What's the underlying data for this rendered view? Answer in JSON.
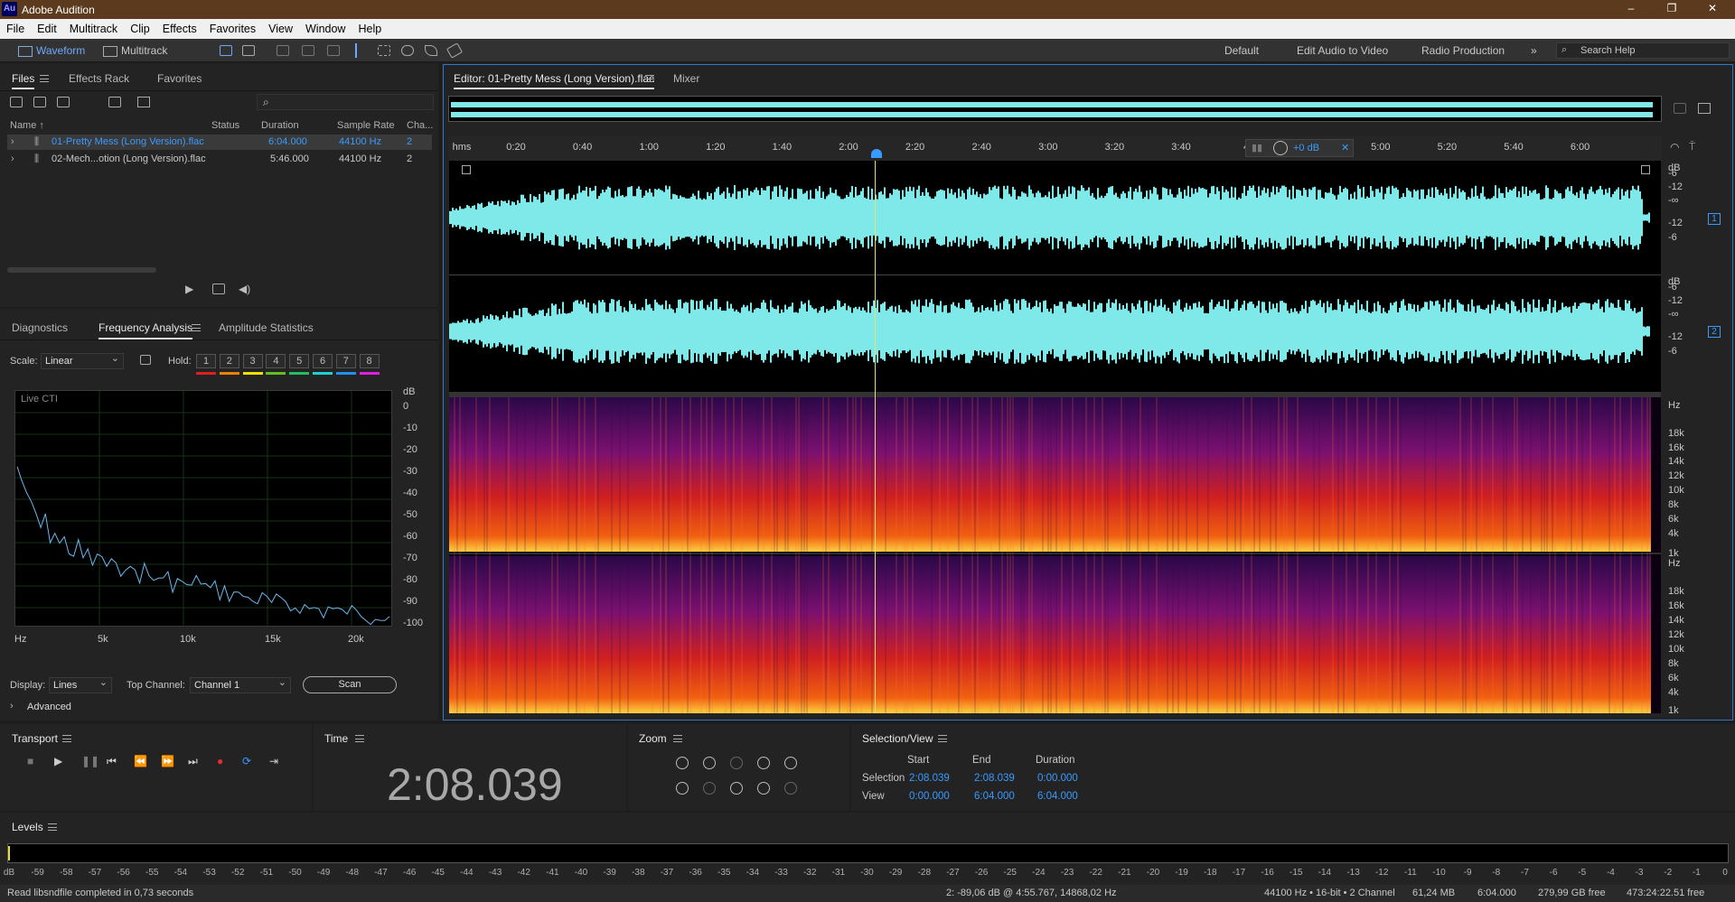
{
  "app": {
    "title": "Adobe Audition",
    "logo": "Au"
  },
  "menu": [
    "File",
    "Edit",
    "Multitrack",
    "Clip",
    "Effects",
    "Favorites",
    "View",
    "Window",
    "Help"
  ],
  "toolbar": {
    "waveform": "Waveform",
    "multitrack": "Multitrack",
    "workspaces": [
      "Default",
      "Edit Audio to Video",
      "Radio Production"
    ],
    "search_placeholder": "Search Help"
  },
  "files_panel": {
    "tabs": [
      "Files",
      "Effects Rack",
      "Favorites"
    ],
    "columns": [
      "Name ↑",
      "Status",
      "Duration",
      "Sample Rate",
      "Cha..."
    ],
    "rows": [
      {
        "name": "01-Pretty Mess (Long Version).flac",
        "duration": "6:04.000",
        "rate": "44100 Hz",
        "ch": "2",
        "selected": true
      },
      {
        "name": "02-Mech...otion (Long Version).flac",
        "duration": "5:46.000",
        "rate": "44100 Hz",
        "ch": "2",
        "selected": false
      }
    ]
  },
  "analysis_panel": {
    "tabs": [
      "Diagnostics",
      "Frequency Analysis",
      "Amplitude Statistics"
    ],
    "scale_label": "Scale:",
    "scale_value": "Linear",
    "hold_label": "Hold:",
    "hold": [
      "1",
      "2",
      "3",
      "4",
      "5",
      "6",
      "7",
      "8"
    ],
    "hold_colors": [
      "#e02020",
      "#f08000",
      "#f0e000",
      "#60c020",
      "#20c060",
      "#20d0d0",
      "#2090f0",
      "#e020e0"
    ],
    "graph_label": "Live CTI",
    "db_label": "dB",
    "db_ticks": [
      "0",
      "-10",
      "-20",
      "-30",
      "-40",
      "-50",
      "-60",
      "-70",
      "-80",
      "-90",
      "-100"
    ],
    "x_ticks": [
      "Hz",
      "5k",
      "10k",
      "15k",
      "20k"
    ],
    "display_label": "Display:",
    "display_value": "Lines",
    "top_channel_label": "Top Channel:",
    "top_channel_value": "Channel 1",
    "scan": "Scan",
    "advanced": "Advanced",
    "spectrum": [
      30,
      36,
      45,
      48,
      52,
      58,
      55,
      62,
      60,
      66,
      64,
      68,
      70,
      67,
      72,
      70,
      74,
      73,
      71,
      76,
      75,
      78,
      77,
      74,
      79,
      78,
      80,
      77,
      81,
      82,
      80,
      83,
      81,
      84,
      82,
      85,
      84,
      86,
      83,
      82,
      85,
      87,
      86,
      88,
      87,
      89,
      88,
      90,
      89,
      91,
      90,
      92,
      91,
      92,
      93,
      92,
      94,
      93,
      95,
      94,
      94,
      95,
      96,
      95,
      96,
      97,
      95,
      96,
      97,
      98,
      96,
      97,
      98,
      97,
      98,
      99,
      97,
      98,
      99,
      98
    ]
  },
  "editor": {
    "tab": "Editor: 01-Pretty Mess (Long Version).flac",
    "mixer": "Mixer",
    "hms": "hms",
    "ruler": [
      "0:20",
      "0:40",
      "1:00",
      "1:20",
      "1:40",
      "2:00",
      "2:20",
      "2:40",
      "3:00",
      "3:20",
      "3:40",
      "4:",
      "4:40",
      "5:00",
      "5:20",
      "5:40",
      "6:00"
    ],
    "vol": "+0 dB",
    "wave_db": [
      "dB",
      "-6",
      "-12",
      "-∞",
      "-12",
      "-6"
    ],
    "spec_hz": [
      "Hz",
      "18k",
      "16k",
      "14k",
      "12k",
      "10k",
      "8k",
      "6k",
      "4k",
      "1k"
    ],
    "channels": [
      "1",
      "2"
    ]
  },
  "transport": {
    "title": "Transport"
  },
  "time": {
    "title": "Time",
    "value": "2:08.039"
  },
  "zoom": {
    "title": "Zoom"
  },
  "selection": {
    "title": "Selection/View",
    "cols": [
      "Start",
      "End",
      "Duration"
    ],
    "rows": [
      {
        "label": "Selection",
        "start": "2:08.039",
        "end": "2:08.039",
        "dur": "0:00.000"
      },
      {
        "label": "View",
        "start": "0:00.000",
        "end": "6:04.000",
        "dur": "6:04.000"
      }
    ]
  },
  "levels": {
    "title": "Levels",
    "ticks": [
      "dB",
      "-59",
      "-58",
      "-57",
      "-56",
      "-55",
      "-54",
      "-53",
      "-52",
      "-51",
      "-50",
      "-49",
      "-48",
      "-47",
      "-46",
      "-45",
      "-44",
      "-43",
      "-42",
      "-41",
      "-40",
      "-39",
      "-38",
      "-37",
      "-36",
      "-35",
      "-34",
      "-33",
      "-32",
      "-31",
      "-30",
      "-29",
      "-28",
      "-27",
      "-26",
      "-25",
      "-24",
      "-23",
      "-22",
      "-21",
      "-20",
      "-19",
      "-18",
      "-17",
      "-16",
      "-15",
      "-14",
      "-13",
      "-12",
      "-11",
      "-10",
      "-9",
      "-8",
      "-7",
      "-6",
      "-5",
      "-4",
      "-3",
      "-2",
      "-1",
      "0"
    ]
  },
  "status": {
    "left": "Read libsndfile completed in 0,73 seconds",
    "info": "2: -89,06 dB @ 4:55.767, 14868,02 Hz",
    "fmt": "44100 Hz • 16-bit • 2 Channel",
    "size": "61,24 MB",
    "dur": "6:04.000",
    "free": "279,99 GB free",
    "time": "473:24:22.51 free"
  }
}
